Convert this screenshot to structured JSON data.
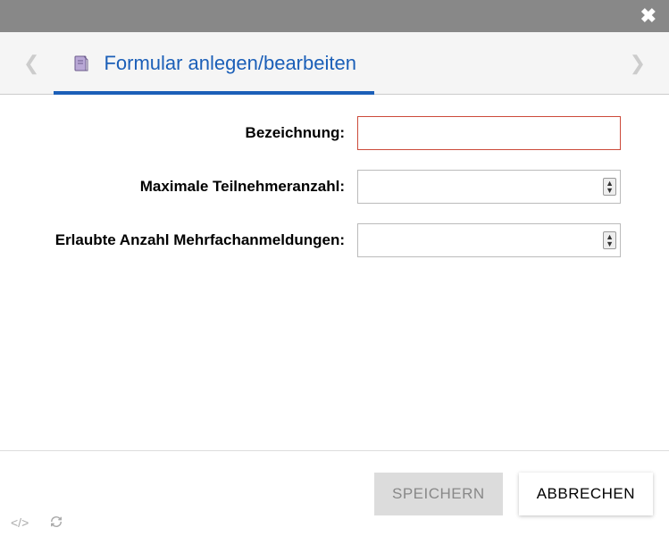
{
  "header": {
    "tab_label": "Formular anlegen/bearbeiten"
  },
  "form": {
    "fields": [
      {
        "label": "Bezeichnung:",
        "value": ""
      },
      {
        "label": "Maximale Teilnehmeranzahl:",
        "value": ""
      },
      {
        "label": "Erlaubte Anzahl Mehrfachanmeldungen:",
        "value": ""
      }
    ]
  },
  "footer": {
    "save_label": "SPEICHERN",
    "cancel_label": "ABBRECHEN"
  }
}
